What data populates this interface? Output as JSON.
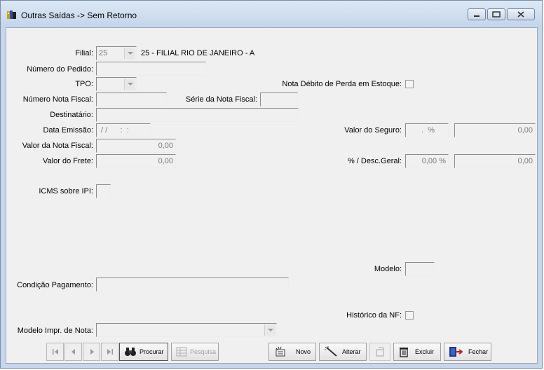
{
  "window": {
    "title": "Outras Saídas -> Sem Retorno"
  },
  "form": {
    "filial_label": "Filial:",
    "filial_value": "25",
    "filial_desc": "25 - FILIAL RIO DE JANEIRO - A",
    "numero_pedido_label": "Número do Pedido:",
    "tpo_label": "TPO:",
    "nota_debito_label": "Nota Débito de Perda em Estoque:",
    "numero_nota_label": "Número Nota Fiscal:",
    "serie_nota_label": "Série da Nota Fiscal:",
    "destinatario_label": "Destinatário:",
    "data_emissao_label": "Data Emissão:",
    "data_emissao_value": " / /      :  :",
    "valor_seguro_label": "Valor do Seguro:",
    "valor_seguro_pct": " .  %",
    "valor_seguro_value": "0,00",
    "valor_nota_label": "Valor da Nota Fiscal:",
    "valor_nota_value": "0,00",
    "valor_frete_label": "Valor do Frete:",
    "valor_frete_value": "0,00",
    "desc_geral_label": "% / Desc.Geral:",
    "desc_geral_pct": "0,00 %",
    "desc_geral_value": "0,00",
    "icms_label": "ICMS sobre IPI:",
    "modelo_label": "Modelo:",
    "condicao_label": "Condição Pagamento:",
    "historico_label": "Histórico da NF:",
    "modelo_impr_label": "Modelo Impr. de Nota:"
  },
  "toolbar": {
    "procurar": "Procurar",
    "pesquisa": "Pesquisa",
    "novo": "Novo",
    "alterar": "Alterar",
    "excluir": "Excluir",
    "fechar": "Fechar"
  }
}
